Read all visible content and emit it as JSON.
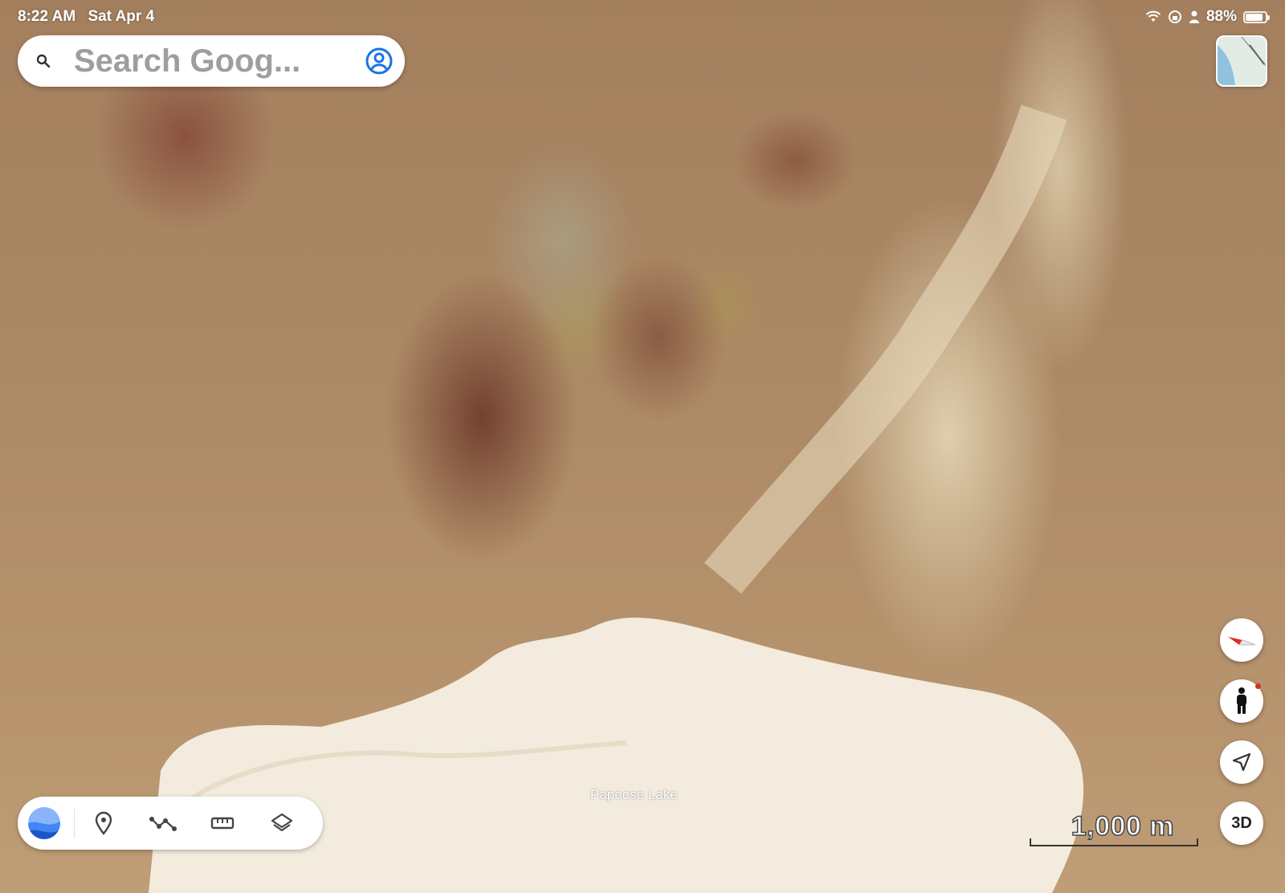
{
  "status_bar": {
    "time": "8:22 AM",
    "date": "Sat Apr 4",
    "battery_percent": "88%",
    "battery_level": 0.88
  },
  "search": {
    "placeholder": "Search Goog...",
    "icons": {
      "search": "magnifier-icon",
      "account": "account-circle-icon"
    }
  },
  "map": {
    "place_label": "Papoose Lake",
    "scale_label": "1,000 m"
  },
  "toolbar": {
    "items": [
      {
        "name": "earth-logo",
        "icon": "google-earth-logo-icon"
      },
      {
        "name": "add-placemark",
        "icon": "map-pin-icon"
      },
      {
        "name": "draw-path",
        "icon": "path-icon"
      },
      {
        "name": "measure",
        "icon": "ruler-icon"
      },
      {
        "name": "layers",
        "icon": "layers-icon"
      }
    ]
  },
  "controls": {
    "compass": "compass-icon",
    "street_view": "pegman-icon",
    "my_location": "location-arrow-icon",
    "three_d_label": "3D"
  },
  "colors": {
    "accent_blue": "#1a73e8",
    "terrain": "#ad8a66",
    "lake": "#f4ede0"
  }
}
